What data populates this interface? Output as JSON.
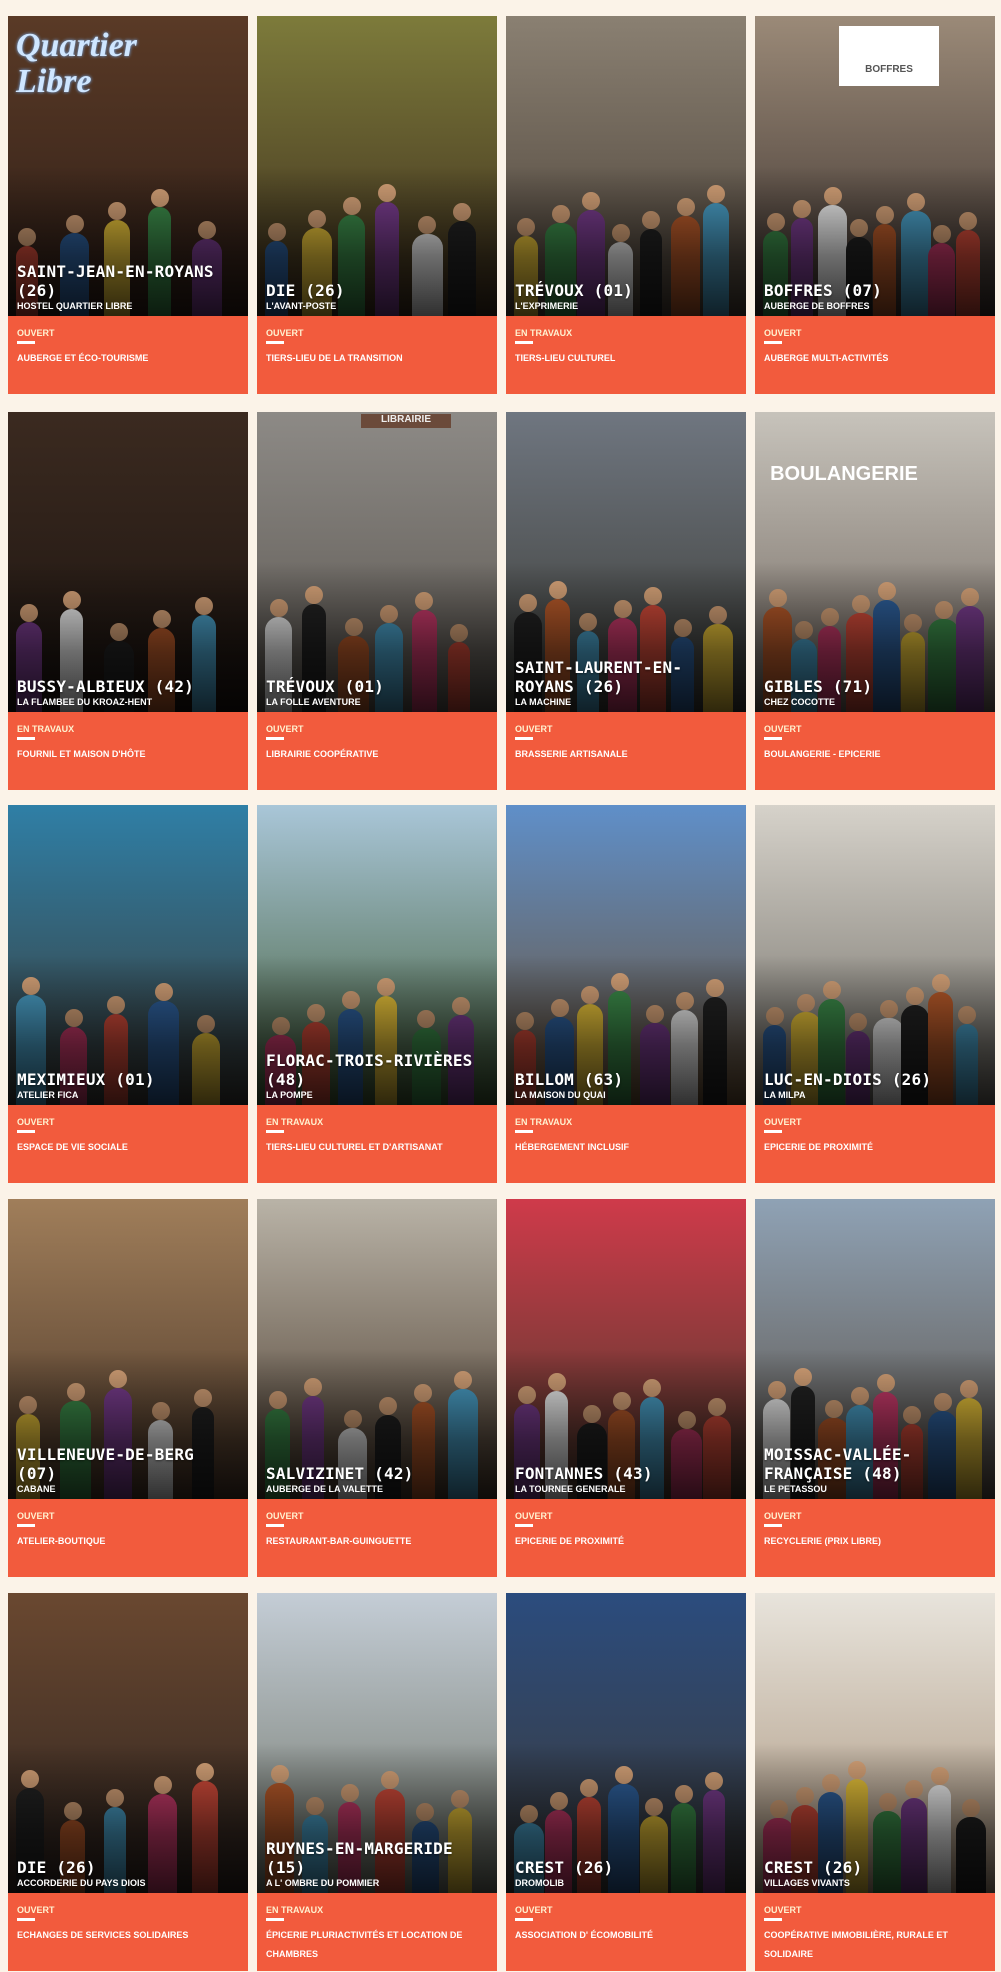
{
  "cards": [
    {
      "place": "SAINT-JEAN-EN-ROYANS (26)",
      "venue": "HOSTEL QUARTIER LIBRE",
      "status": "OUVERT",
      "category": "AUBERGE ET ÉCO-TOURISME",
      "sign": "Quartier Libre",
      "bg": "#5a3a26",
      "bg2": "#2e1e17"
    },
    {
      "place": "DIE (26)",
      "venue": "L'AVANT-POSTE",
      "status": "OUVERT",
      "category": "TIERS-LIEU DE LA TRANSITION",
      "bg": "#7d7b3b",
      "bg2": "#3c2c1c"
    },
    {
      "place": "TRÉVOUX (01)",
      "venue": "L'EXPRIMERIE",
      "status": "EN TRAVAUX",
      "category": "TIERS-LIEU CULTUREL",
      "bg": "#8a8072",
      "bg2": "#4a4036"
    },
    {
      "place": "BOFFRES (07)",
      "venue": "AUBERGE DE BOFFRES",
      "status": "OUVERT",
      "category": "AUBERGE MULTI-ACTIVITÉS",
      "sign": "BOFFRES",
      "bg": "#9b8a78",
      "bg2": "#3a302c"
    },
    {
      "place": "BUSSY-ALBIEUX (42)",
      "venue": "LA FLAMBEE DU KROAZ-HENT",
      "status": "EN TRAVAUX",
      "category": "FOURNIL ET MAISON D'HÔTE",
      "bg": "#3b2a20",
      "bg2": "#1c1410"
    },
    {
      "place": "TRÉVOUX (01)",
      "venue": "LA FOLLE AVENTURE",
      "status": "OUVERT",
      "category": "LIBRAIRIE COOPÉRATIVE",
      "sign": "LIBRAIRIE",
      "bg": "#8d8a86",
      "bg2": "#5a554f"
    },
    {
      "place": "SAINT-LAURENT-EN-ROYANS (26)",
      "venue": "LA MACHINE",
      "status": "OUVERT",
      "category": "BRASSERIE ARTISANALE",
      "bg": "#6f7680",
      "bg2": "#3a3a34"
    },
    {
      "place": "GIBLES (71)",
      "venue": "CHEZ COCOTTE",
      "status": "OUVERT",
      "category": "BOULANGERIE - EPICERIE",
      "sign": "BOULANGERIE",
      "bg": "#c7c3bb",
      "bg2": "#6e645c"
    },
    {
      "place": "MEXIMIEUX (01)",
      "venue": "ATELIER FICA",
      "status": "OUVERT",
      "category": "ESPACE DE VIE SOCIALE",
      "bg": "#2f7fa6",
      "bg2": "#3b3a36"
    },
    {
      "place": "FLORAC-TROIS-RIVIÈRES (48)",
      "venue": "LA POMPE",
      "status": "EN TRAVAUX",
      "category": "TIERS-LIEU CULTUREL ET D'ARTISANAT",
      "bg": "#a9c6d8",
      "bg2": "#3f5a34"
    },
    {
      "place": "BILLOM (63)",
      "venue": "LA MAISON DU QUAI",
      "status": "EN TRAVAUX",
      "category": "HÉBERGEMENT INCLUSIF",
      "bg": "#5f8fc9",
      "bg2": "#6b5134"
    },
    {
      "place": "LUC-EN-DIOIS (26)",
      "venue": "LA MILPA",
      "status": "OUVERT",
      "category": "EPICERIE DE PROXIMITÉ",
      "bg": "#d6d2ca",
      "bg2": "#6d6a63"
    },
    {
      "place": "VILLENEUVE-DE-BERG (07)",
      "venue": "CABANE",
      "status": "OUVERT",
      "category": "ATELIER-BOUTIQUE",
      "bg": "#a07e5a",
      "bg2": "#4a3628"
    },
    {
      "place": "SALVIZINET (42)",
      "venue": "AUBERGE DE LA VALETTE",
      "status": "OUVERT",
      "category": "RESTAURANT-BAR-GUINGUETTE",
      "bg": "#b9b3a7",
      "bg2": "#4a3a2c"
    },
    {
      "place": "FONTANNES (43)",
      "venue": "LA TOURNEE GENERALE",
      "status": "OUVERT",
      "category": "EPICERIE DE PROXIMITÉ",
      "bg": "#cf3a4a",
      "bg2": "#4a3a2c"
    },
    {
      "place": "MOISSAC-VALLÉE-FRANÇAISE (48)",
      "venue": "LE PETASSOU",
      "status": "OUVERT",
      "category": "RECYCLERIE (PRIX LIBRE)",
      "bg": "#8fa2b5",
      "bg2": "#5a5046"
    },
    {
      "place": "DIE (26)",
      "venue": "ACCORDERIE DU PAYS DIOIS",
      "status": "OUVERT",
      "category": "ECHANGES DE SERVICES SOLIDAIRES",
      "bg": "#6a4830",
      "bg2": "#2e2420"
    },
    {
      "place": "RUYNES-EN-MARGERIDE (15)",
      "venue": "A L' OMBRE DU POMMIER",
      "status": "EN TRAVAUX",
      "category": "ÉPICERIE PLURIACTIVITÉS ET LOCATION DE CHAMBRES",
      "bg": "#c4cdd6",
      "bg2": "#6f7468"
    },
    {
      "place": "CREST (26)",
      "venue": "DROMOLIB",
      "status": "OUVERT",
      "category": "ASSOCIATION D' ÉCOMOBILITÉ",
      "bg": "#2b4c7e",
      "bg2": "#3c3a38"
    },
    {
      "place": "CREST (26)",
      "venue": "VILLAGES VIVANTS",
      "status": "OUVERT",
      "category": "COOPÉRATIVE IMMOBILIÈRE, RURALE ET SOLIDAIRE",
      "bg": "#e8e4dc",
      "bg2": "#a8927a"
    }
  ]
}
